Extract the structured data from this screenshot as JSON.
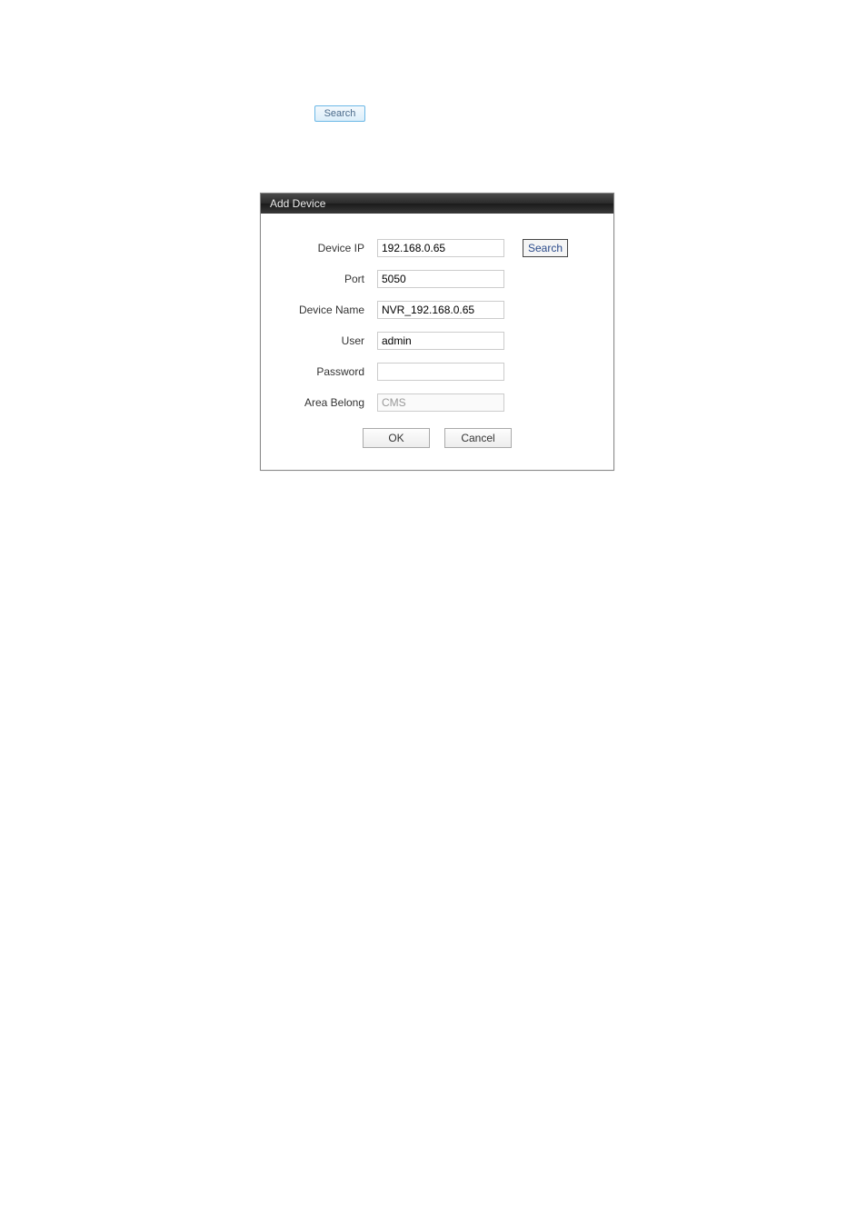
{
  "top_search_button": "Search",
  "dialog": {
    "title": "Add Device",
    "labels": {
      "device_ip": "Device IP",
      "port": "Port",
      "device_name": "Device Name",
      "user": "User",
      "password": "Password",
      "area_belong": "Area Belong"
    },
    "values": {
      "device_ip": "192.168.0.65",
      "port": "5050",
      "device_name": "NVR_192.168.0.65",
      "user": "admin",
      "password": "",
      "area_belong": "CMS"
    },
    "buttons": {
      "search": "Search",
      "ok": "OK",
      "cancel": "Cancel"
    }
  }
}
